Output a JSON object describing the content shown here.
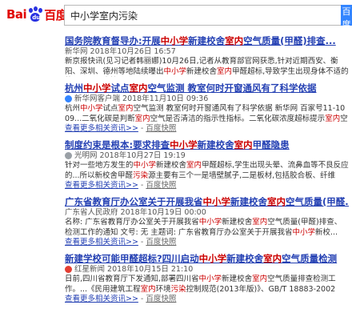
{
  "logo": {
    "text_left": "Bai",
    "text_paw": "du",
    "text_right": "百度"
  },
  "search": {
    "query": "中小学室内污染",
    "button_label": "百度一下"
  },
  "results": [
    {
      "title_parts": [
        [
          "国务院教育督导办:开展",
          false
        ],
        [
          "中小学",
          true
        ],
        [
          "新建校舍",
          false
        ],
        [
          "室内",
          true
        ],
        [
          "空气质量(甲醛)排查",
          false
        ],
        [
          "...",
          false
        ]
      ],
      "source": "新华网  2018年10月26日 16:57",
      "source_icon": "none",
      "abstract_parts": [
        [
          "新京报快讯(见习记者韩丽娜)10月26日,记者从教育部官网获悉,针对近期西安、衡阳、深圳、德州等地陆续曝出",
          false
        ],
        [
          "中小学",
          true
        ],
        [
          "新建校舍",
          false
        ],
        [
          "室内",
          true
        ],
        [
          "甲醛超标,导致学生出现身体不适的状况...",
          false
        ]
      ],
      "inline_snapshot": "百度快照",
      "more_link": "",
      "snapshot_link": ""
    },
    {
      "title_parts": [
        [
          "杭州",
          false
        ],
        [
          "中小学",
          true
        ],
        [
          "试点",
          false
        ],
        [
          "室内",
          true
        ],
        [
          "空气监测 教室何时开窗通风有了科学依据",
          false
        ]
      ],
      "source": "新华网客户端  2018年11月10日 09:36",
      "source_icon": "blue",
      "abstract_parts": [
        [
          "杭州",
          false
        ],
        [
          "中小学",
          true
        ],
        [
          "试点",
          false
        ],
        [
          "室内",
          true
        ],
        [
          "空气监测 教室何时开窗通风有了科学依据 新华网 百家号11-1009...二氧化碳是判断",
          false
        ],
        [
          "室内",
          true
        ],
        [
          "空气是否清洁的指示性指标。二氧化碳浓度超标提示",
          false
        ],
        [
          "室内",
          true
        ],
        [
          "空气",
          false
        ],
        [
          "污染",
          true
        ],
        [
          "...",
          false
        ]
      ],
      "inline_snapshot": "",
      "more_link": "查看更多相关资讯>>",
      "snapshot_link": "百度快照"
    },
    {
      "title_parts": [
        [
          "制度约束是根本:要求排查",
          false
        ],
        [
          "中小学",
          true
        ],
        [
          "新建校舍",
          false
        ],
        [
          "室内",
          true
        ],
        [
          "甲醛隐患",
          false
        ]
      ],
      "source": "光明网  2018年10月27日 19:19",
      "source_icon": "gray",
      "abstract_parts": [
        [
          "针对一些地方发生的",
          false
        ],
        [
          "中小学",
          true
        ],
        [
          "新建校舍",
          false
        ],
        [
          "室内",
          true
        ],
        [
          "甲醛超标,学生出现头晕、流鼻血等不良反应的...所以新校舍甲醛",
          false
        ],
        [
          "污染",
          true
        ],
        [
          "源主要有三个一是墙壁腻子,二是板材,包括胶合板、纤维板...",
          false
        ]
      ],
      "inline_snapshot": "",
      "more_link": "查看更多相关资讯>>",
      "snapshot_link": "百度快照"
    },
    {
      "title_parts": [
        [
          "广东省教育厅办公室关于开展我省",
          false
        ],
        [
          "中小学",
          true
        ],
        [
          "新建校舍",
          false
        ],
        [
          "室内",
          true
        ],
        [
          "空气质量(甲醛...",
          false
        ]
      ],
      "source": "广东省人民政府  2018年10月19日 00:00",
      "source_icon": "none",
      "abstract_parts": [
        [
          "名称: 广东省教育厅办公室关于开展我省",
          false
        ],
        [
          "中小学",
          true
        ],
        [
          "新建校舍",
          false
        ],
        [
          "室内",
          true
        ],
        [
          "空气质量(甲醛)排查、检测工作的通知 文号: 无 主题词: 广东省教育厅办公室关于开展我省",
          false
        ],
        [
          "中小学",
          true
        ],
        [
          "新校...",
          false
        ]
      ],
      "inline_snapshot": "",
      "more_link": "查看更多相关资讯>>",
      "snapshot_link": "百度快照"
    },
    {
      "title_parts": [
        [
          "新建学校可能甲醛超标?四川启动",
          false
        ],
        [
          "中小学",
          true
        ],
        [
          "新建校舍",
          false
        ],
        [
          "室内",
          true
        ],
        [
          "空气质量检测",
          false
        ]
      ],
      "source": "红星新闻  2018年10月15日 21:10",
      "source_icon": "red",
      "abstract_parts": [
        [
          "日前,四川省教育厅下发通知,部署四川省",
          false
        ],
        [
          "中小学",
          true
        ],
        [
          "新建校舍",
          false
        ],
        [
          "室内",
          true
        ],
        [
          "空气质量排查检测工作。...《民用建筑工程",
          false
        ],
        [
          "室内",
          true
        ],
        [
          "环境",
          false
        ],
        [
          "污染",
          true
        ],
        [
          "控制规范(2013年版)》、GB/T 18883-2002《",
          false
        ],
        [
          "室内",
          true
        ],
        [
          "...",
          false
        ]
      ],
      "inline_snapshot": "",
      "more_link": "查看更多相关资讯>>",
      "snapshot_link": "百度快照"
    }
  ]
}
